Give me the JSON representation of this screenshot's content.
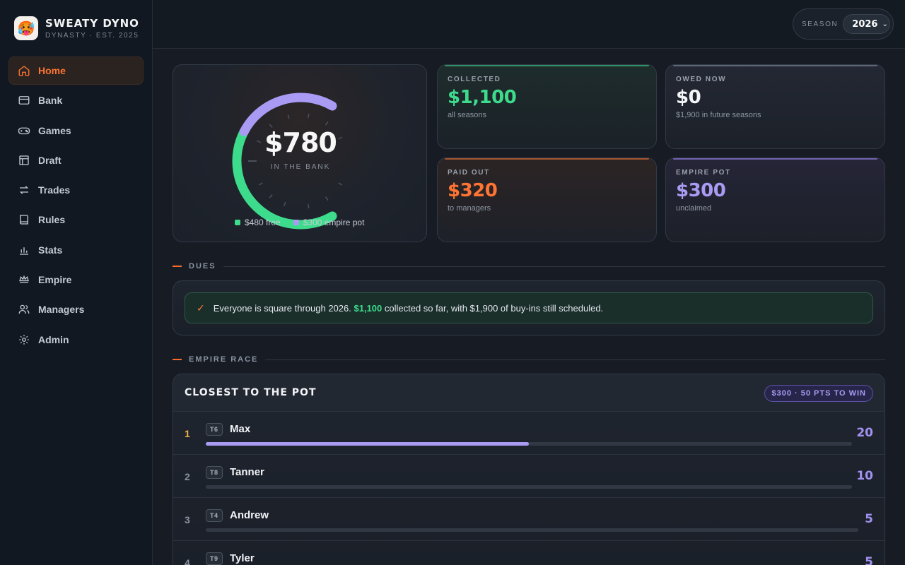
{
  "brand": {
    "name": "SWEATY DYNO",
    "subtitle": "DYNASTY · EST. 2025",
    "logo_icon": "hot-face-emoji"
  },
  "nav": [
    {
      "label": "Home",
      "icon": "home-icon",
      "active": true
    },
    {
      "label": "Bank",
      "icon": "wallet-icon"
    },
    {
      "label": "Games",
      "icon": "gamepad-icon"
    },
    {
      "label": "Draft",
      "icon": "grid-icon"
    },
    {
      "label": "Trades",
      "icon": "swap-icon"
    },
    {
      "label": "Rules",
      "icon": "book-icon"
    },
    {
      "label": "Stats",
      "icon": "bar-chart-icon"
    },
    {
      "label": "Empire",
      "icon": "crown-icon"
    },
    {
      "label": "Managers",
      "icon": "users-icon"
    },
    {
      "label": "Admin",
      "icon": "gear-icon"
    }
  ],
  "season": {
    "label": "SEASON",
    "value": "2026"
  },
  "bank": {
    "amount": "$780",
    "label": "IN THE BANK",
    "free_fraction": 0.615,
    "legend": [
      {
        "label": "$480 free",
        "color": "#3ddc8c"
      },
      {
        "label": "$300 empire pot",
        "color": "#a99bf3"
      }
    ]
  },
  "stats": {
    "collected": {
      "label": "COLLECTED",
      "value": "$1,100",
      "note": "all seasons",
      "color": "#3ddc8c"
    },
    "owed": {
      "label": "OWED NOW",
      "value": "$0",
      "note": "$1,900 in future seasons",
      "color": "#f4f5f7"
    },
    "paid": {
      "label": "PAID OUT",
      "value": "$320",
      "note": "to managers",
      "color": "#ff7433"
    },
    "pot": {
      "label": "EMPIRE POT",
      "value": "$300",
      "note": "unclaimed",
      "color": "#a99bf3"
    }
  },
  "dues": {
    "section_title": "DUES",
    "message_pre": "Everyone is square through 2026.",
    "message_highlight": "$1,100",
    "message_post": "collected so far, with $1,900 of buy-ins still scheduled."
  },
  "empire": {
    "section_title": "EMPIRE RACE",
    "card_title": "CLOSEST TO THE POT",
    "pill": "$300 · 50 PTS TO WIN",
    "rows": [
      {
        "rank": "1",
        "team": "T6",
        "manager": "Max",
        "points": "20",
        "progress": 0.5
      },
      {
        "rank": "2",
        "team": "T8",
        "manager": "Tanner",
        "points": "10",
        "progress": 0
      },
      {
        "rank": "3",
        "team": "T4",
        "manager": "Andrew",
        "points": "5",
        "progress": 0
      },
      {
        "rank": "4",
        "team": "T9",
        "manager": "Tyler",
        "points": "5",
        "progress": 0
      }
    ]
  }
}
